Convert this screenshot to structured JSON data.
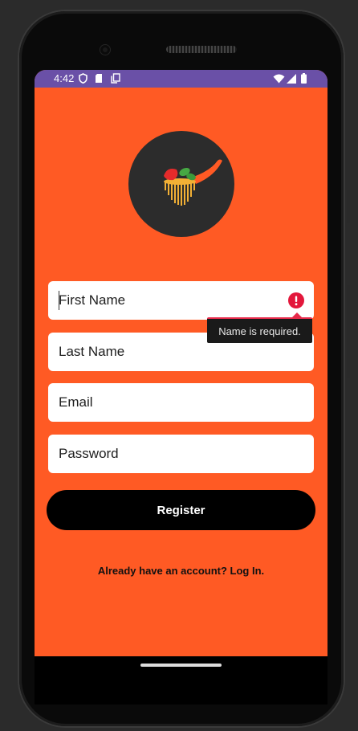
{
  "status_bar": {
    "time": "4:42",
    "left_icons": [
      "shield-icon",
      "sd-card-icon",
      "copy-icon"
    ],
    "right_icons": [
      "wifi-icon",
      "signal-icon",
      "battery-icon"
    ],
    "color": "#6a50a7"
  },
  "app": {
    "background_color": "#ff5a24",
    "logo_icon": "spaghetti-fork-logo-icon"
  },
  "form": {
    "first_name": {
      "placeholder": "First Name",
      "error_icon": "error-icon",
      "error_message": "Name is required."
    },
    "last_name": {
      "placeholder": "Last Name"
    },
    "email": {
      "placeholder": "Email"
    },
    "password": {
      "placeholder": "Password"
    },
    "register_label": "Register",
    "login_prompt": "Already have an account? Log In."
  }
}
